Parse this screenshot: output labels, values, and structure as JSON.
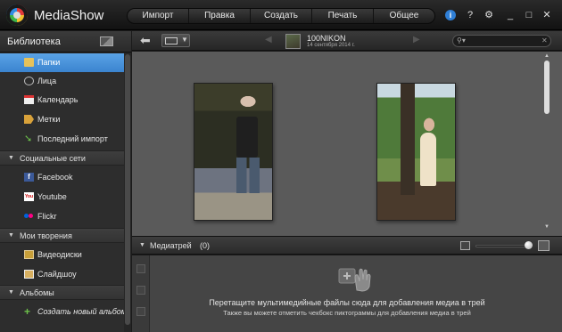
{
  "app": {
    "title": "MediaShow"
  },
  "menu": {
    "items": [
      "Импорт",
      "Правка",
      "Создать",
      "Печать",
      "Общее"
    ]
  },
  "titlebar_icons": {
    "update": "i",
    "help": "?",
    "settings": "gear-icon",
    "minimize": "_",
    "maximize": "□",
    "close": "✕"
  },
  "sidebar": {
    "header": "Библиотека",
    "library_items": [
      {
        "label": "Папки",
        "icon": "folder-icon",
        "selected": true
      },
      {
        "label": "Лица",
        "icon": "face-icon"
      },
      {
        "label": "Календарь",
        "icon": "calendar-icon"
      },
      {
        "label": "Метки",
        "icon": "tag-icon"
      },
      {
        "label": "Последний импорт",
        "icon": "import-icon"
      }
    ],
    "sections": {
      "social": {
        "label": "Социальные сети",
        "items": [
          {
            "label": "Facebook",
            "icon": "facebook-icon",
            "glyph": "f"
          },
          {
            "label": "Youtube",
            "icon": "youtube-icon",
            "glyph": "You"
          },
          {
            "label": "Flickr",
            "icon": "flickr-icon"
          }
        ]
      },
      "creations": {
        "label": "Мои творения",
        "items": [
          {
            "label": "Видеодиски",
            "icon": "disc-icon"
          },
          {
            "label": "Слайдшоу",
            "icon": "slideshow-icon"
          }
        ]
      },
      "albums": {
        "label": "Альбомы",
        "items": [
          {
            "label": "Создать новый альбом",
            "icon": "plus-icon",
            "glyph": "+"
          }
        ]
      }
    }
  },
  "toolbar": {
    "album_name": "100NIKON",
    "album_date": "14 сентября 2014 г.",
    "search_placeholder": "",
    "search_clear": "✕"
  },
  "gallery": {
    "photos": [
      {
        "subject": "boy"
      },
      {
        "subject": "girl"
      }
    ]
  },
  "tray": {
    "label": "Медиатрей",
    "count": "(0)",
    "hint_primary": "Перетащите мультимедийные файлы сюда для добавления медиа в трей",
    "hint_secondary": "Также вы можете отметить чекбокс пиктограммы для добавления медиа в трей"
  },
  "colors": {
    "accent": "#4a95dd",
    "background": "#2d2d2d",
    "gallery_bg": "#5a5a5a"
  }
}
